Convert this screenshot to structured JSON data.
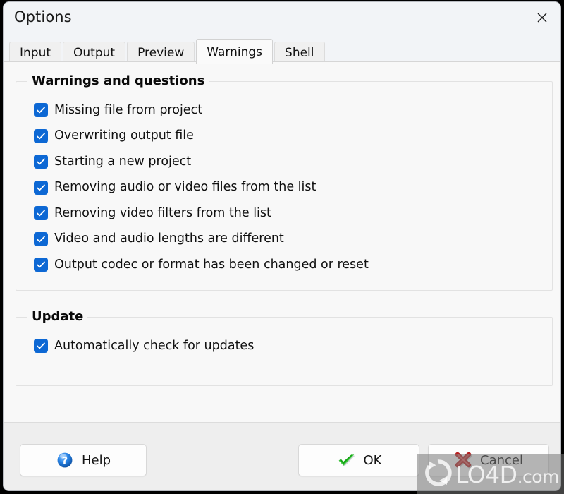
{
  "window": {
    "title": "Options",
    "close_icon": "close-icon"
  },
  "tabs": [
    {
      "label": "Input",
      "active": false
    },
    {
      "label": "Output",
      "active": false
    },
    {
      "label": "Preview",
      "active": false
    },
    {
      "label": "Warnings",
      "active": true
    },
    {
      "label": "Shell",
      "active": false
    }
  ],
  "groups": [
    {
      "legend": "Warnings and questions",
      "items": [
        {
          "label": "Missing file from project",
          "checked": true
        },
        {
          "label": "Overwriting output file",
          "checked": true
        },
        {
          "label": "Starting a new project",
          "checked": true
        },
        {
          "label": "Removing audio or video files from the list",
          "checked": true
        },
        {
          "label": "Removing video filters from the list",
          "checked": true
        },
        {
          "label": "Video and audio lengths are different",
          "checked": true
        },
        {
          "label": "Output codec or format has been changed or reset",
          "checked": true
        }
      ]
    },
    {
      "legend": "Update",
      "items": [
        {
          "label": "Automatically check for updates",
          "checked": true
        }
      ]
    }
  ],
  "footer": {
    "help": {
      "label": "Help",
      "icon": "help-question-icon"
    },
    "ok": {
      "label": "OK",
      "icon": "green-check-icon"
    },
    "cancel": {
      "label": "Cancel",
      "icon": "red-cross-icon"
    }
  },
  "watermark": {
    "name": "LO4D",
    "suffix": ".com"
  },
  "colors": {
    "checkbox_blue": "#0d68d4",
    "ok_green": "#19a019",
    "cancel_red": "#cc2222",
    "help_blue": "#1f7fe0",
    "window_bg": "#f1f3f6",
    "content_bg": "#f8f8f8"
  }
}
